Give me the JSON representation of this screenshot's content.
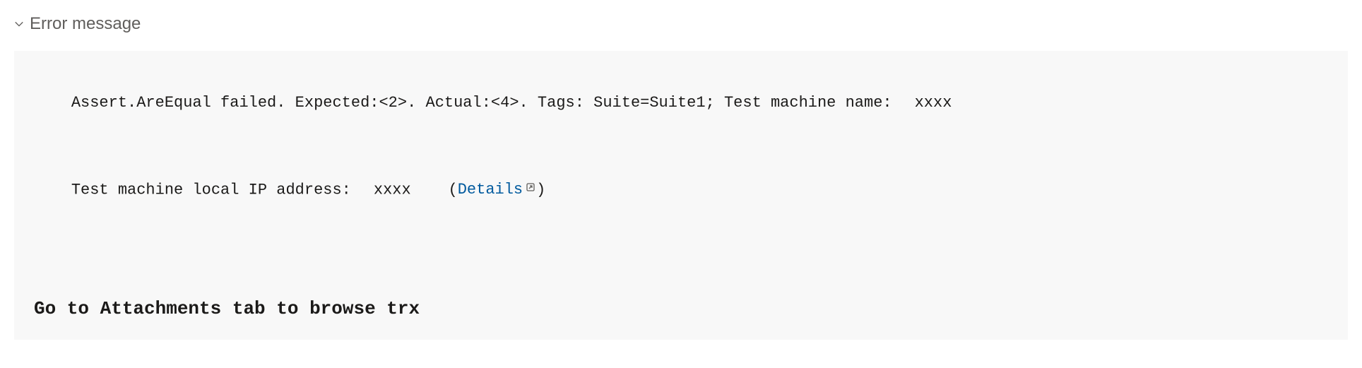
{
  "section": {
    "title": "Error message"
  },
  "error": {
    "line1_prefix": "Assert.AreEqual failed. Expected:<2>. Actual:<4>. Tags: Suite=Suite1; Test machine name:",
    "line1_value": "xxxx",
    "line2_prefix": "Test machine local IP address:",
    "line2_value": "xxxx",
    "details_label": "Details",
    "attachments_hint": "Go to Attachments tab to browse trx"
  }
}
